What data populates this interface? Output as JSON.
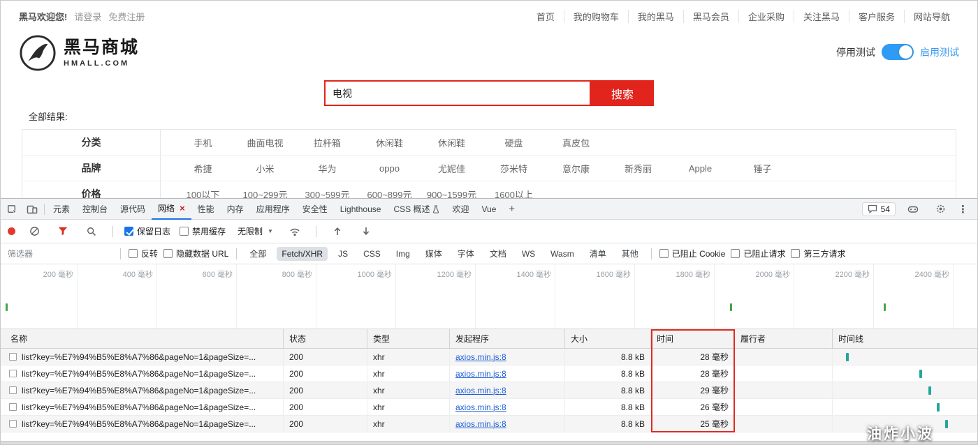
{
  "site": {
    "topbar": {
      "welcome": "黑马欢迎您!",
      "login": "请登录",
      "register": "免费注册",
      "links": [
        "首页",
        "我的购物车",
        "我的黑马",
        "黑马会员",
        "企业采购",
        "关注黑马",
        "客户服务",
        "网站导航"
      ]
    },
    "logo": {
      "name": "黑马商城",
      "domain": "HMALL.COM"
    },
    "test_toggle": {
      "left_label": "停用测试",
      "right_label": "启用测试",
      "state": "on"
    },
    "search": {
      "value": "电视",
      "button_label": "搜索"
    },
    "results_label": "全部结果:",
    "filter_rows": [
      {
        "label": "分类",
        "options": [
          "手机",
          "曲面电视",
          "拉杆箱",
          "休闲鞋",
          "休闲鞋",
          "硬盘",
          "真皮包"
        ]
      },
      {
        "label": "品牌",
        "options": [
          "希捷",
          "小米",
          "华为",
          "oppo",
          "尤妮佳",
          "莎米特",
          "意尔康",
          "新秀丽",
          "Apple",
          "锤子"
        ]
      },
      {
        "label": "价格",
        "options": [
          "100以下",
          "100~299元",
          "300~599元",
          "600~899元",
          "900~1599元",
          "1600以上"
        ]
      }
    ],
    "colors": {
      "brand_red": "#e1251c",
      "toggle_blue": "#2f9bf4"
    }
  },
  "devtools": {
    "tabs": [
      "元素",
      "控制台",
      "源代码",
      "网络",
      "性能",
      "内存",
      "应用程序",
      "安全性",
      "Lighthouse",
      "CSS 概述",
      "欢迎",
      "Vue"
    ],
    "active_tab": "网络",
    "issues_count": "54",
    "toolbar": {
      "preserve_log_label": "保留日志",
      "preserve_log_checked": true,
      "disable_cache_label": "禁用缓存",
      "disable_cache_checked": false,
      "throttling_value": "无限制"
    },
    "filters": {
      "placeholder": "筛选器",
      "invert_label": "反转",
      "hide_data_urls_label": "隐藏数据 URL",
      "type_pills": [
        "全部",
        "Fetch/XHR",
        "JS",
        "CSS",
        "Img",
        "媒体",
        "字体",
        "文档",
        "WS",
        "Wasm",
        "清单",
        "其他"
      ],
      "selected_pill": "Fetch/XHR",
      "blocked_cookies_label": "已阻止 Cookie",
      "blocked_requests_label": "已阻止请求",
      "third_party_label": "第三方请求"
    },
    "overview": {
      "time_labels": [
        "200 毫秒",
        "400 毫秒",
        "600 毫秒",
        "800 毫秒",
        "1000 毫秒",
        "1200 毫秒",
        "1400 毫秒",
        "1600 毫秒",
        "1800 毫秒",
        "2000 毫秒",
        "2200 毫秒",
        "2400 毫秒"
      ],
      "activity_ticks": [
        "0.5%",
        "74.7%",
        "90.4%"
      ]
    },
    "network_table": {
      "headers": [
        "名称",
        "状态",
        "类型",
        "发起程序",
        "大小",
        "时间",
        "履行者",
        "时间线"
      ],
      "highlighted_column": "时间",
      "rows": [
        {
          "name": "list?key=%E7%94%B5%E8%A7%86&pageNo=1&pageSize=...",
          "status": "200",
          "type": "xhr",
          "initiator": "axios.min.js:8",
          "size": "8.8 kB",
          "time": "28 毫秒",
          "fulfilled_by": "",
          "bar_left": "9%"
        },
        {
          "name": "list?key=%E7%94%B5%E8%A7%86&pageNo=1&pageSize=...",
          "status": "200",
          "type": "xhr",
          "initiator": "axios.min.js:8",
          "size": "8.8 kB",
          "time": "28 毫秒",
          "fulfilled_by": "",
          "bar_left": "60%"
        },
        {
          "name": "list?key=%E7%94%B5%E8%A7%86&pageNo=1&pageSize=...",
          "status": "200",
          "type": "xhr",
          "initiator": "axios.min.js:8",
          "size": "8.8 kB",
          "time": "29 毫秒",
          "fulfilled_by": "",
          "bar_left": "66%"
        },
        {
          "name": "list?key=%E7%94%B5%E8%A7%86&pageNo=1&pageSize=...",
          "status": "200",
          "type": "xhr",
          "initiator": "axios.min.js:8",
          "size": "8.8 kB",
          "time": "26 毫秒",
          "fulfilled_by": "",
          "bar_left": "72%"
        },
        {
          "name": "list?key=%E7%94%B5%E8%A7%86&pageNo=1&pageSize=...",
          "status": "200",
          "type": "xhr",
          "initiator": "axios.min.js:8",
          "size": "8.8 kB",
          "time": "25 毫秒",
          "fulfilled_by": "",
          "bar_left": "78%"
        }
      ]
    },
    "watermark": "油炸小波"
  }
}
